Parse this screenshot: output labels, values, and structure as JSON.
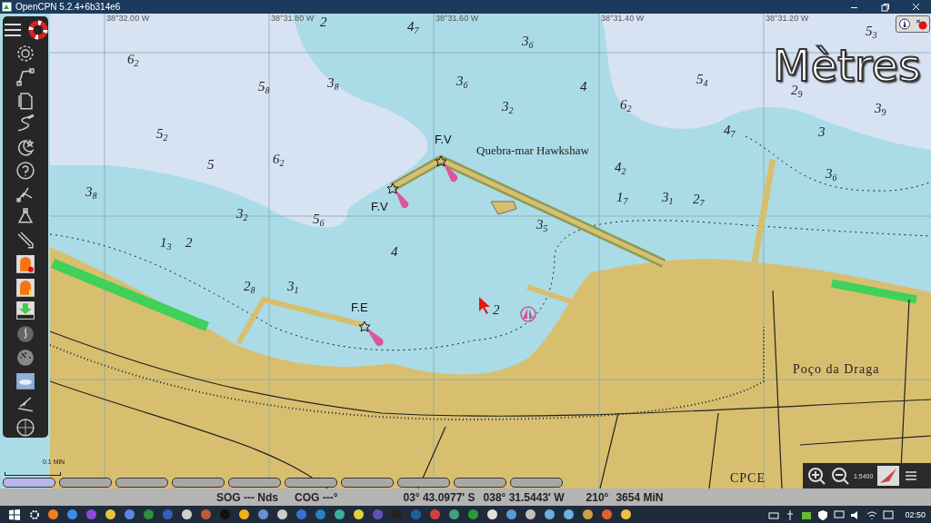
{
  "window": {
    "title": "OpenCPN 5.2.4+6b314e6"
  },
  "grid_labels": [
    "38°32.00 W",
    "38°31.80 W",
    "38°31.60 W",
    "38°31.40 W",
    "38°31.20 W"
  ],
  "depth_unit_overlay": "Mètres",
  "soundings": [
    "2",
    "4$_{7}$",
    "5$_{3}$",
    "3$_{6}$",
    "6$_{2}$",
    "5$_{8}$",
    "3$_{8}$",
    "3$_{6}$",
    "4",
    "5$_{4}$",
    "2$_{9}$",
    "3$_{2}$",
    "6$_{2}$",
    "3$_{9}$",
    "5$_{2}$",
    "4$_{7}$",
    "3",
    "5",
    "6$_{2}$",
    "4$_{2}$",
    "3$_{6}$",
    "3$_{8}$",
    "1$_{7}$",
    "3$_{1}$",
    "2$_{7}$",
    "3$_{2}$",
    "5$_{6}$",
    "3$_{5}$",
    "1$_{3}$",
    "2",
    "4",
    "2$_{8}$",
    "3$_{1}$",
    "2"
  ],
  "map_labels": [
    {
      "kind": "light",
      "text": "F.V"
    },
    {
      "kind": "name",
      "text": "Quebra-mar Hawkshaw"
    },
    {
      "kind": "light",
      "text": "F.V"
    },
    {
      "kind": "light",
      "text": "F.E"
    },
    {
      "kind": "name",
      "text": "Poço da Draga"
    },
    {
      "kind": "name",
      "text": "CPCE"
    }
  ],
  "scale_bar": "0.1 MiN",
  "chart_bar": [
    {
      "selected": true
    },
    {
      "selected": false
    },
    {
      "selected": false
    },
    {
      "selected": false
    },
    {
      "selected": false
    },
    {
      "selected": false
    },
    {
      "selected": false
    },
    {
      "selected": false
    },
    {
      "selected": false
    },
    {
      "selected": false
    }
  ],
  "zoom_scale": "1:5400",
  "status_bar": [
    {
      "text": "SOG --- Nds"
    },
    {
      "text": "COG ---°"
    },
    {
      "text": "03° 43.0977' S"
    },
    {
      "text": "038° 31.5443' W"
    },
    {
      "text": "210°"
    },
    {
      "text": "3654 MiN"
    }
  ],
  "taskbar": {
    "clock": "02:50"
  }
}
